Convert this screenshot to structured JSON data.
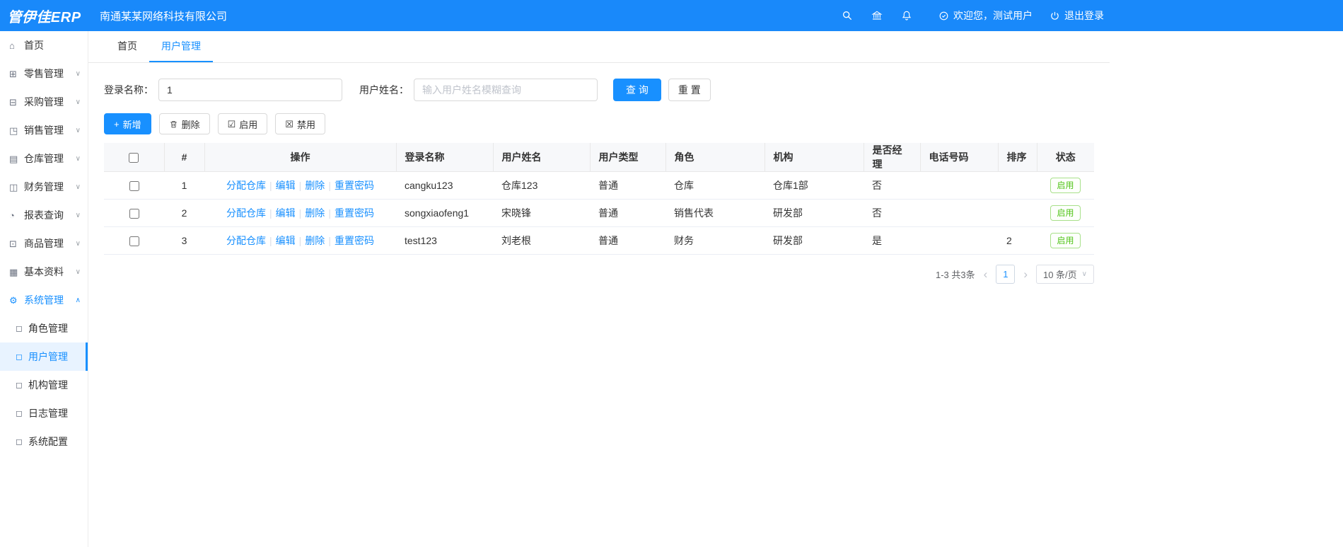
{
  "colors": {
    "primary": "#1890ff",
    "header_bg": "#1989fa",
    "success": "#52c41a"
  },
  "header": {
    "logo": "管伊佳ERP",
    "company": "南通某某网络科技有限公司",
    "welcome": "欢迎您，测试用户",
    "logout": "退出登录"
  },
  "icons": {
    "home": "⌂",
    "retail": "⊞",
    "purchase": "⊟",
    "sales": "◳",
    "warehouse": "▤",
    "finance": "◫",
    "report": "◔",
    "product": "⊡",
    "basic": "▦",
    "system": "⚙",
    "submenu": "◻",
    "chevron_down": "∨",
    "chevron_up": "∧",
    "plus": "+",
    "enable_box": "☑",
    "disable_box": "☒",
    "page_prev": "‹",
    "page_next": "›",
    "select_arrow": "∨",
    "sep": "|"
  },
  "sidebar": {
    "items": [
      {
        "label": "首页"
      },
      {
        "label": "零售管理"
      },
      {
        "label": "采购管理"
      },
      {
        "label": "销售管理"
      },
      {
        "label": "仓库管理"
      },
      {
        "label": "财务管理"
      },
      {
        "label": "报表查询"
      },
      {
        "label": "商品管理"
      },
      {
        "label": "基本资料"
      },
      {
        "label": "系统管理"
      }
    ],
    "submenu": [
      {
        "label": "角色管理"
      },
      {
        "label": "用户管理"
      },
      {
        "label": "机构管理"
      },
      {
        "label": "日志管理"
      },
      {
        "label": "系统配置"
      }
    ]
  },
  "tabs": {
    "home": "首页",
    "current": "用户管理"
  },
  "filter": {
    "login_label": "登录名称：",
    "login_value": "1",
    "name_label": "用户姓名：",
    "name_placeholder": "输入用户姓名模糊查询",
    "search": "查 询",
    "reset": "重 置"
  },
  "toolbar": {
    "add": "新增",
    "delete": "删除",
    "enable": "启用",
    "disable": "禁用"
  },
  "table": {
    "headers": {
      "index": "#",
      "actions": "操作",
      "login": "登录名称",
      "name": "用户姓名",
      "type": "用户类型",
      "role": "角色",
      "org": "机构",
      "manager": "是否经理",
      "phone": "电话号码",
      "sort": "排序",
      "status": "状态"
    },
    "actions": {
      "assign": "分配仓库",
      "edit": "编辑",
      "del": "删除",
      "reset_pwd": "重置密码"
    },
    "rows": [
      {
        "index": "1",
        "login": "cangku123",
        "name": "仓库123",
        "type": "普通",
        "role": "仓库",
        "org": "仓库1部",
        "manager": "否",
        "phone": "",
        "sort": "",
        "status": "启用"
      },
      {
        "index": "2",
        "login": "songxiaofeng1",
        "name": "宋晓锋",
        "type": "普通",
        "role": "销售代表",
        "org": "研发部",
        "manager": "否",
        "phone": "",
        "sort": "",
        "status": "启用"
      },
      {
        "index": "3",
        "login": "test123",
        "name": "刘老根",
        "type": "普通",
        "role": "财务",
        "org": "研发部",
        "manager": "是",
        "phone": "",
        "sort": "2",
        "status": "启用"
      }
    ]
  },
  "pagination": {
    "summary": "1-3 共3条",
    "page": "1",
    "page_size": "10 条/页"
  }
}
